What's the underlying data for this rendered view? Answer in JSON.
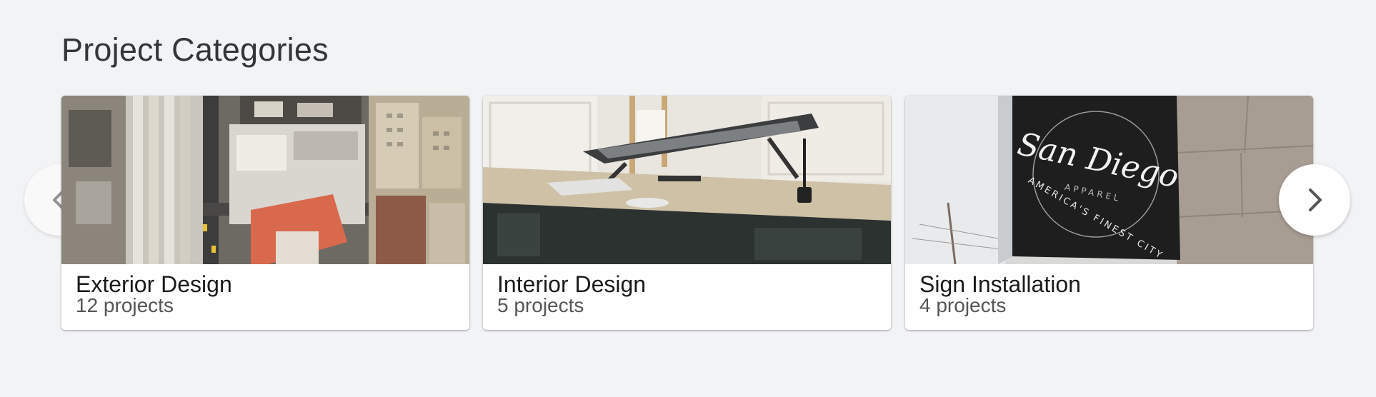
{
  "section": {
    "title": "Project Categories"
  },
  "carousel": {
    "prev_icon": "chevron-left-icon",
    "next_icon": "chevron-right-icon",
    "cards": [
      {
        "title": "Exterior Design",
        "count": "12 projects",
        "image": "city-aerial-photo"
      },
      {
        "title": "Interior Design",
        "count": "5 projects",
        "image": "desk-tablet-photo"
      },
      {
        "title": "Sign Installation",
        "count": "4 projects",
        "image": "san-diego-sign-photo"
      }
    ]
  },
  "sign_image_text": {
    "line1": "San Diego",
    "line2": "APPAREL",
    "line3": "AMERICA'S FINEST CITY"
  }
}
